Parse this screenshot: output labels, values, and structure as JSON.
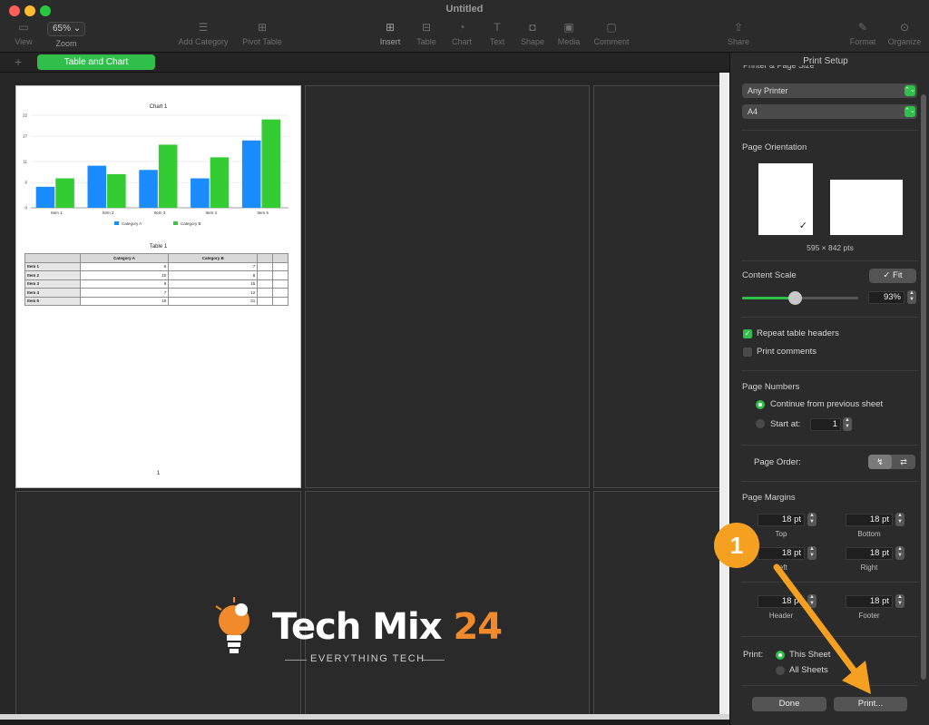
{
  "window": {
    "title": "Untitled"
  },
  "toolbar": {
    "view": "View",
    "zoom_value": "65%",
    "zoom_label": "Zoom",
    "add_category": "Add Category",
    "pivot_table": "Pivot Table",
    "insert": "Insert",
    "table": "Table",
    "chart": "Chart",
    "text": "Text",
    "shape": "Shape",
    "media": "Media",
    "comment": "Comment",
    "share": "Share",
    "format": "Format",
    "organize": "Organize"
  },
  "sheet_tab": {
    "label": "Table and Chart"
  },
  "print_page": {
    "page_number": "1",
    "chart": {
      "title": "Chart 1",
      "legend": [
        "Category A",
        "Category B"
      ]
    },
    "table": {
      "title": "Table 1",
      "headers": [
        "",
        "Category A",
        "Category B",
        "",
        ""
      ],
      "rows": [
        [
          "Item 1",
          "5",
          "7"
        ],
        [
          "Item 2",
          "10",
          "8"
        ],
        [
          "Item 3",
          "9",
          "15"
        ],
        [
          "Item 4",
          "7",
          "12"
        ],
        [
          "Item 5",
          "16",
          "21"
        ]
      ]
    }
  },
  "chart_data": {
    "type": "bar",
    "title": "Chart 1",
    "categories": [
      "Item 1",
      "Item 2",
      "Item 3",
      "Item 4",
      "Item 5"
    ],
    "series": [
      {
        "name": "Category A",
        "values": [
          5,
          10,
          9,
          7,
          16
        ],
        "color": "#1a8cff"
      },
      {
        "name": "Category B",
        "values": [
          7,
          8,
          15,
          12,
          21
        ],
        "color": "#33cc33"
      }
    ],
    "y_ticks": [
      "0",
      "6",
      "11",
      "17",
      "22"
    ],
    "ylim": [
      0,
      22
    ],
    "legend_position": "bottom",
    "grid": true
  },
  "panel": {
    "title": "Print Setup",
    "printer_heading": "Printer & Page Size",
    "printer": "Any Printer",
    "paper": "A4",
    "orientation_heading": "Page Orientation",
    "page_size": "595 × 842 pts",
    "content_scale_heading": "Content Scale",
    "fit_button": "✓ Fit",
    "scale_value": "93%",
    "scale_fraction": 0.93,
    "repeat_headers": "Repeat table headers",
    "print_comments": "Print comments",
    "page_numbers_heading": "Page Numbers",
    "continue_previous": "Continue from previous sheet",
    "start_at": "Start at:",
    "start_at_value": "1",
    "page_order_label": "Page Order:",
    "page_margins_heading": "Page Margins",
    "margins": {
      "top": {
        "value": "18 pt",
        "label": "Top"
      },
      "bottom": {
        "value": "18 pt",
        "label": "Bottom"
      },
      "left": {
        "value": "18 pt",
        "label": "Left"
      },
      "right": {
        "value": "18 pt",
        "label": "Right"
      },
      "header": {
        "value": "18 pt",
        "label": "Header"
      },
      "footer": {
        "value": "18 pt",
        "label": "Footer"
      }
    },
    "print_label": "Print:",
    "this_sheet": "This Sheet",
    "all_sheets": "All Sheets",
    "done_button": "Done",
    "print_button": "Print..."
  },
  "annotation": {
    "step": "1",
    "color": "#f5a020"
  },
  "watermark": {
    "name_a": "Tech Mix ",
    "name_b": "24",
    "tagline": "EVERYTHING TECH"
  }
}
